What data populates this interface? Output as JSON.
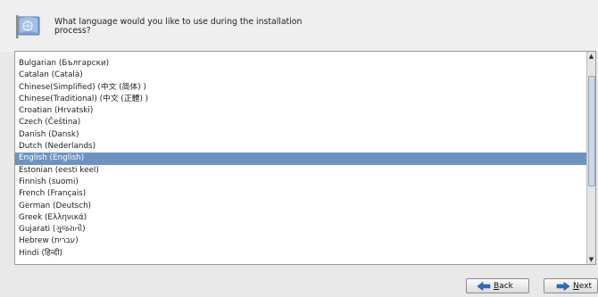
{
  "header": {
    "prompt": "What language would you like to use during the installation process?",
    "icon": "flag-icon"
  },
  "languages": [
    "Bulgarian (Български)",
    "Catalan (Català)",
    "Chinese(Simplified) (中文 (简体) )",
    "Chinese(Traditional) (中文 (正體) )",
    "Croatian (Hrvatski)",
    "Czech (Čeština)",
    "Danish (Dansk)",
    "Dutch (Nederlands)",
    "English (English)",
    "Estonian (eesti keel)",
    "Finnish (suomi)",
    "French (Français)",
    "German (Deutsch)",
    "Greek (Ελληνικά)",
    "Gujarati (ગુજરાતી)",
    "Hebrew (עברית)",
    "Hindi (हिन्दी)"
  ],
  "selected_language": "English (English)",
  "colors": {
    "selection": "#6e93c0",
    "arrow_blue": "#2f6fbf"
  },
  "buttons": {
    "back": {
      "pre": "",
      "mnemonic": "B",
      "post": "ack"
    },
    "next": {
      "pre": "",
      "mnemonic": "N",
      "post": "ext"
    }
  }
}
